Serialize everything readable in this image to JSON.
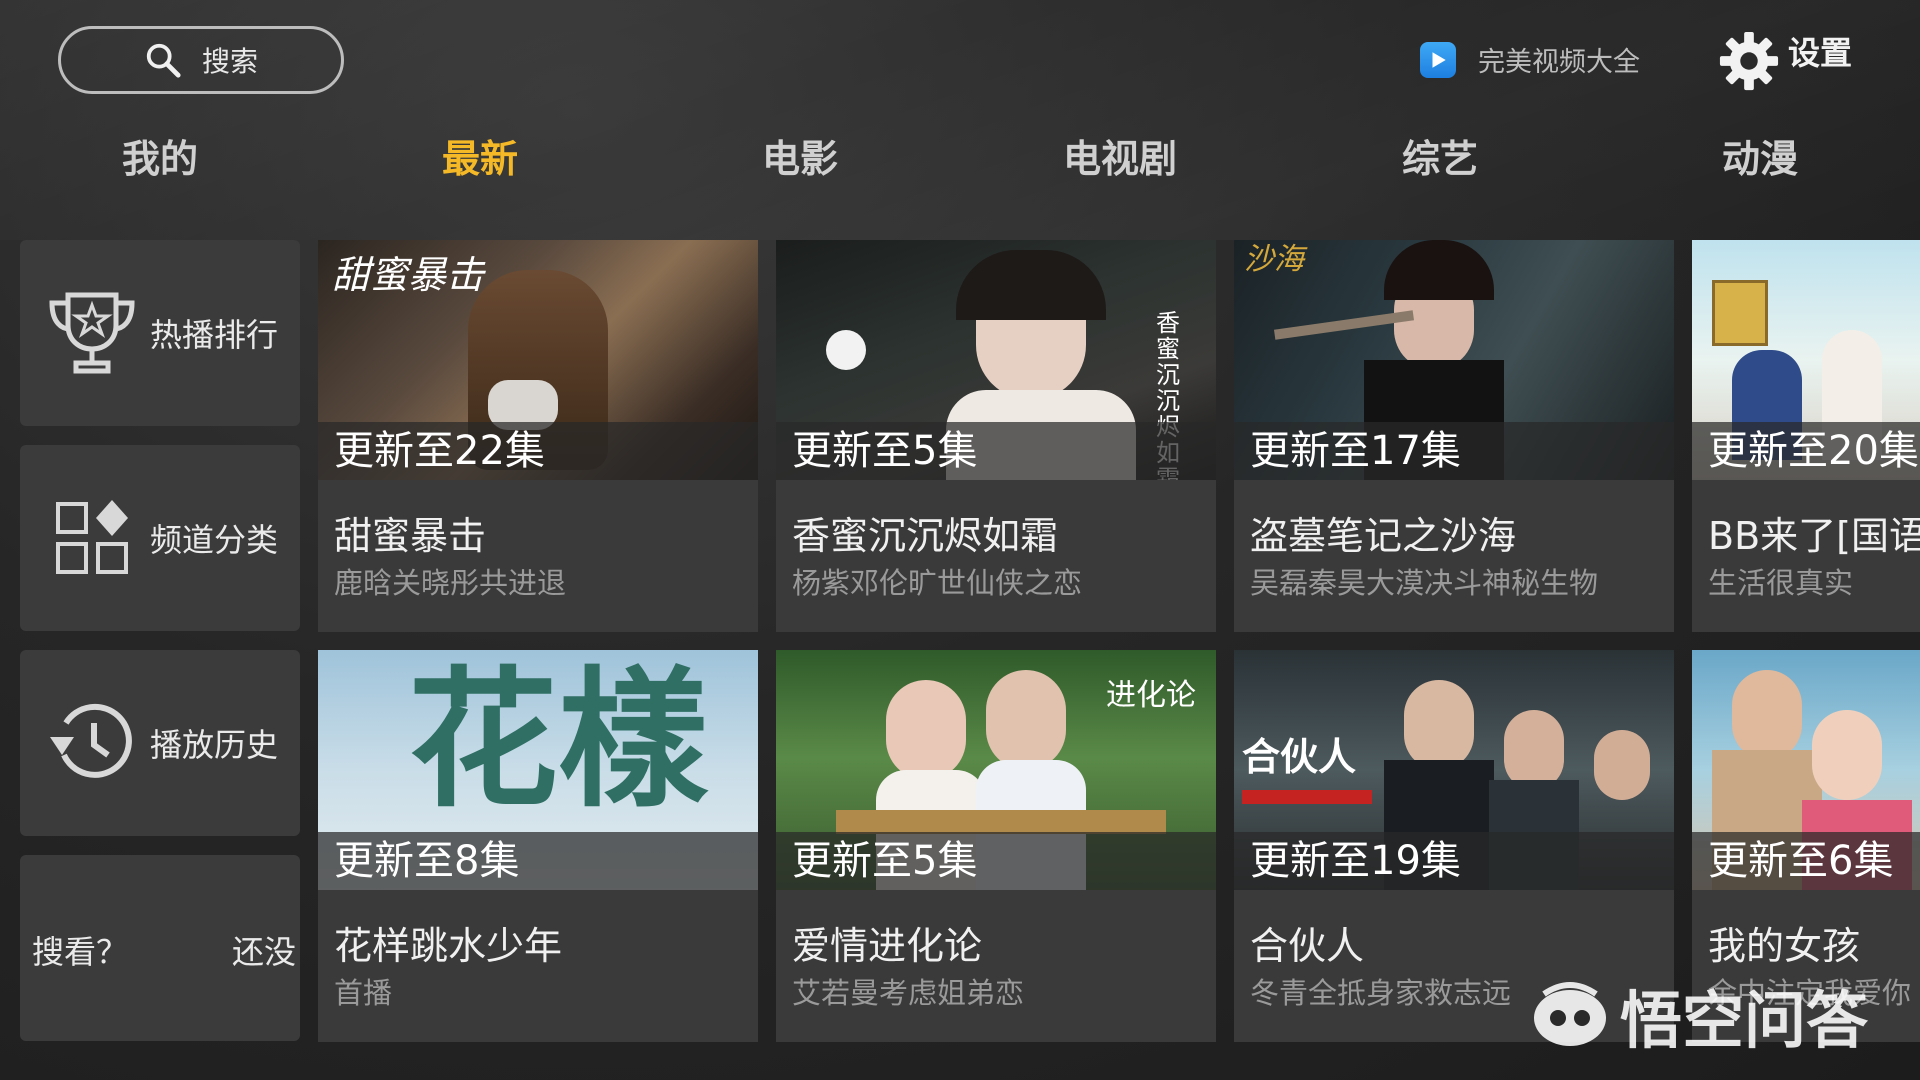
{
  "header": {
    "search_label": "搜索",
    "brand_text": "完美视频大全",
    "settings_label": "设置"
  },
  "tabs": [
    {
      "label": "我的",
      "active": false
    },
    {
      "label": "最新",
      "active": true
    },
    {
      "label": "电影",
      "active": false
    },
    {
      "label": "电视剧",
      "active": false
    },
    {
      "label": "综艺",
      "active": false
    },
    {
      "label": "动漫",
      "active": false
    }
  ],
  "sidebar": {
    "items": [
      {
        "label": "热播排行",
        "icon": "trophy-icon"
      },
      {
        "label": "频道分类",
        "icon": "grid-icon"
      },
      {
        "label": "播放历史",
        "icon": "history-icon"
      }
    ],
    "marquee": {
      "left": "搜看？",
      "right": "还没"
    }
  },
  "cards": [
    {
      "badge": "更新至22集",
      "title": "甜蜜暴击",
      "subtitle": "鹿晗关晓彤共进退",
      "poster_text": "甜蜜暴击"
    },
    {
      "badge": "更新至5集",
      "title": "香蜜沉沉烬如霜",
      "subtitle": "杨紫邓伦旷世仙侠之恋",
      "poster_text": "香蜜沉沉烬如霜"
    },
    {
      "badge": "更新至17集",
      "title": "盗墓笔记之沙海",
      "subtitle": "吴磊秦昊大漠决斗神秘生物",
      "poster_text": "沙海"
    },
    {
      "badge": "更新至20集",
      "title": "BB来了[国语]",
      "subtitle": "生活很真实",
      "poster_text": ""
    },
    {
      "badge": "更新至8集",
      "title": "花样跳水少年",
      "subtitle": "首播",
      "poster_text": "花樣"
    },
    {
      "badge": "更新至5集",
      "title": "爱情进化论",
      "subtitle": "艾若曼考虑姐弟恋",
      "poster_text": "进化论"
    },
    {
      "badge": "更新至19集",
      "title": "合伙人",
      "subtitle": "冬青全抵身家救志远",
      "poster_text": "合伙人"
    },
    {
      "badge": "更新至6集",
      "title": "我的女孩",
      "subtitle": "余中注定我爱你",
      "poster_text": ""
    }
  ],
  "watermark": {
    "text": "悟空问答"
  },
  "colors": {
    "accent": "#f5b927",
    "card_bg": "#3a3a3a",
    "brand_blue": "#1d7fe0"
  }
}
